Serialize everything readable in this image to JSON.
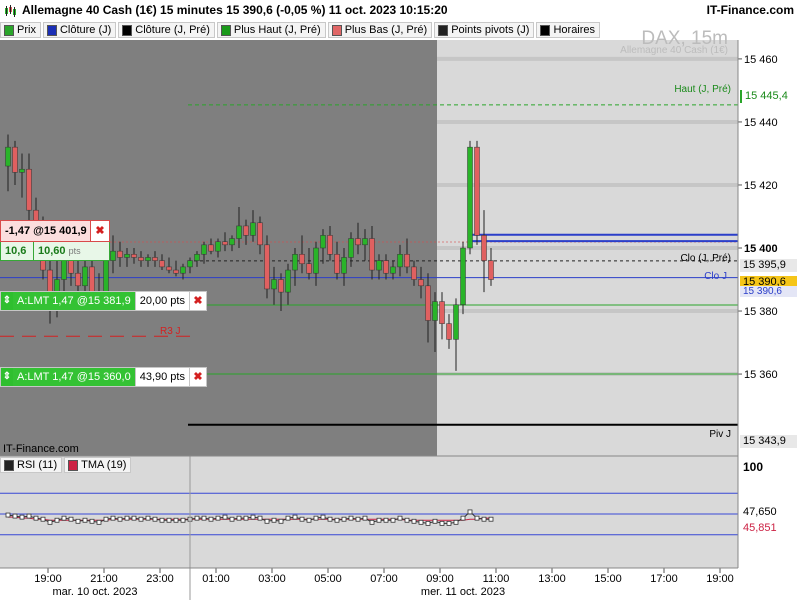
{
  "header": {
    "title": "Allemagne 40 Cash (1€) 15 minutes 15 390,6 (-0,05 %) 11 oct. 2023 10:15:20",
    "brand": "IT-Finance.com"
  },
  "legend": [
    {
      "label": "Prix",
      "color": "#2aa52a"
    },
    {
      "label": "Clôture (J)",
      "color": "#1b2fb5"
    },
    {
      "label": "Clôture (J, Pré)",
      "color": "#000000"
    },
    {
      "label": "Plus Haut (J, Pré)",
      "color": "#1a9a1a"
    },
    {
      "label": "Plus Bas (J, Pré)",
      "color": "#e06666"
    },
    {
      "label": "Points pivots (J)",
      "color": "#222222"
    },
    {
      "label": "Horaires",
      "color": "#000000"
    }
  ],
  "watermark": {
    "symbol": "DAX, 15m",
    "name": "Allemagne 40 Cash (1€)"
  },
  "footer_brand": "IT-Finance.com",
  "position": {
    "value": "-1,47 @15 401,9",
    "close": "✖",
    "pl_points": "10,6",
    "pl_value": "10,60",
    "pl_unit": "pts"
  },
  "orders": [
    {
      "grip": "⇕",
      "label": "A:LMT 1,47 @15 381,9",
      "pts": "20,00 pts",
      "close": "✖"
    },
    {
      "grip": "⇕",
      "label": "A:LMT 1,47 @15 360,0",
      "pts": "43,90 pts",
      "close": "✖"
    }
  ],
  "line_labels": {
    "high_prev": "Haut (J, Pré)",
    "close_prev": "Clo (J, Pré)",
    "close_j": "Clo J",
    "pivot": "Piv J",
    "r3": "R3 J"
  },
  "price_tags": {
    "high_prev": "15 445,4",
    "close_prev": "15 395,9",
    "current": "15 390,6",
    "close_j": "15 390,6",
    "pivot": "15 343,9"
  },
  "colors": {
    "up": "#29b429",
    "down": "#e06060",
    "wick": "#222222",
    "session_shade": "#7f7f7f",
    "chart_bg": "#d9d9d9",
    "blue_line": "#2b3ec9",
    "green_line": "#2aa52a",
    "rsi_line": "#333333",
    "tma_line": "#cc2244",
    "rsi_band": "#3949d6",
    "current_tag": "#f5c518"
  },
  "rsi_legend": [
    {
      "label": "RSI (11)",
      "color": "#222222"
    },
    {
      "label": "TMA (19)",
      "color": "#cc2244"
    }
  ],
  "rsi_tags": {
    "max": "100",
    "rsi": "47,650",
    "tma": "45,851"
  },
  "chart_data": {
    "type": "candlestick",
    "title": "Allemagne 40 Cash (1€) 15 minutes",
    "y_axis": {
      "ticks": [
        "15 460",
        "15 440",
        "15 420",
        "15 400",
        "15 380",
        "15 360"
      ],
      "ylim": [
        15334,
        15466
      ]
    },
    "x_axis": {
      "ticks": [
        "19:00",
        "21:00",
        "23:00",
        "01:00",
        "03:00",
        "05:00",
        "07:00",
        "09:00",
        "11:00",
        "13:00",
        "15:00",
        "17:00",
        "19:00"
      ],
      "dates": [
        "mar. 10 oct. 2023",
        "mer. 11 oct. 2023"
      ]
    },
    "levels": {
      "high_prev": 15445.4,
      "close_prev": 15395.9,
      "close_j": 15390.6,
      "pivot": 15343.9,
      "r3": 15372,
      "order_1": 15381.9,
      "order_2": 15360.0,
      "position": 15401.9,
      "blue_band": [
        15404.2,
        15402.2
      ],
      "green_low": 15360.3
    },
    "candles": [
      {
        "o": 15426,
        "h": 15436,
        "l": 15418,
        "c": 15432
      },
      {
        "o": 15432,
        "h": 15434,
        "l": 15420,
        "c": 15424
      },
      {
        "o": 15424,
        "h": 15430,
        "l": 15416,
        "c": 15425
      },
      {
        "o": 15425,
        "h": 15430,
        "l": 15408,
        "c": 15412
      },
      {
        "o": 15412,
        "h": 15416,
        "l": 15398,
        "c": 15400
      },
      {
        "o": 15400,
        "h": 15410,
        "l": 15390,
        "c": 15393
      },
      {
        "o": 15393,
        "h": 15396,
        "l": 15376,
        "c": 15382
      },
      {
        "o": 15382,
        "h": 15396,
        "l": 15378,
        "c": 15390
      },
      {
        "o": 15390,
        "h": 15402,
        "l": 15386,
        "c": 15398
      },
      {
        "o": 15398,
        "h": 15402,
        "l": 15388,
        "c": 15392
      },
      {
        "o": 15392,
        "h": 15396,
        "l": 15382,
        "c": 15388
      },
      {
        "o": 15388,
        "h": 15398,
        "l": 15384,
        "c": 15394
      },
      {
        "o": 15394,
        "h": 15398,
        "l": 15382,
        "c": 15386
      },
      {
        "o": 15386,
        "h": 15392,
        "l": 15380,
        "c": 15384
      },
      {
        "o": 15384,
        "h": 15398,
        "l": 15382,
        "c": 15396
      },
      {
        "o": 15396,
        "h": 15404,
        "l": 15392,
        "c": 15399
      },
      {
        "o": 15399,
        "h": 15402,
        "l": 15394,
        "c": 15397
      },
      {
        "o": 15397,
        "h": 15400,
        "l": 15394,
        "c": 15398
      },
      {
        "o": 15398,
        "h": 15400,
        "l": 15395,
        "c": 15397
      },
      {
        "o": 15397,
        "h": 15399,
        "l": 15394,
        "c": 15396
      },
      {
        "o": 15396,
        "h": 15398,
        "l": 15394,
        "c": 15397
      },
      {
        "o": 15397,
        "h": 15399,
        "l": 15394,
        "c": 15396
      },
      {
        "o": 15396,
        "h": 15398,
        "l": 15393,
        "c": 15394
      },
      {
        "o": 15394,
        "h": 15397,
        "l": 15392,
        "c": 15393
      },
      {
        "o": 15393,
        "h": 15396,
        "l": 15391,
        "c": 15392
      },
      {
        "o": 15392,
        "h": 15395,
        "l": 15390,
        "c": 15394
      },
      {
        "o": 15394,
        "h": 15397,
        "l": 15392,
        "c": 15396
      },
      {
        "o": 15396,
        "h": 15399,
        "l": 15394,
        "c": 15398
      },
      {
        "o": 15398,
        "h": 15402,
        "l": 15395,
        "c": 15401
      },
      {
        "o": 15401,
        "h": 15403,
        "l": 15398,
        "c": 15399
      },
      {
        "o": 15399,
        "h": 15403,
        "l": 15397,
        "c": 15402
      },
      {
        "o": 15402,
        "h": 15405,
        "l": 15399,
        "c": 15401
      },
      {
        "o": 15401,
        "h": 15404,
        "l": 15399,
        "c": 15403
      },
      {
        "o": 15403,
        "h": 15413,
        "l": 15400,
        "c": 15407
      },
      {
        "o": 15407,
        "h": 15409,
        "l": 15401,
        "c": 15404
      },
      {
        "o": 15404,
        "h": 15412,
        "l": 15402,
        "c": 15408
      },
      {
        "o": 15408,
        "h": 15410,
        "l": 15398,
        "c": 15401
      },
      {
        "o": 15401,
        "h": 15404,
        "l": 15384,
        "c": 15387
      },
      {
        "o": 15387,
        "h": 15394,
        "l": 15382,
        "c": 15390
      },
      {
        "o": 15390,
        "h": 15392,
        "l": 15380,
        "c": 15386
      },
      {
        "o": 15386,
        "h": 15395,
        "l": 15382,
        "c": 15393
      },
      {
        "o": 15393,
        "h": 15400,
        "l": 15388,
        "c": 15398
      },
      {
        "o": 15398,
        "h": 15404,
        "l": 15392,
        "c": 15395
      },
      {
        "o": 15395,
        "h": 15400,
        "l": 15390,
        "c": 15392
      },
      {
        "o": 15392,
        "h": 15402,
        "l": 15388,
        "c": 15400
      },
      {
        "o": 15400,
        "h": 15406,
        "l": 15395,
        "c": 15404
      },
      {
        "o": 15404,
        "h": 15407,
        "l": 15396,
        "c": 15398
      },
      {
        "o": 15398,
        "h": 15402,
        "l": 15390,
        "c": 15392
      },
      {
        "o": 15392,
        "h": 15400,
        "l": 15388,
        "c": 15397
      },
      {
        "o": 15397,
        "h": 15405,
        "l": 15394,
        "c": 15403
      },
      {
        "o": 15403,
        "h": 15408,
        "l": 15398,
        "c": 15401
      },
      {
        "o": 15401,
        "h": 15406,
        "l": 15396,
        "c": 15403
      },
      {
        "o": 15403,
        "h": 15407,
        "l": 15390,
        "c": 15393
      },
      {
        "o": 15393,
        "h": 15398,
        "l": 15390,
        "c": 15396
      },
      {
        "o": 15396,
        "h": 15398,
        "l": 15390,
        "c": 15392
      },
      {
        "o": 15392,
        "h": 15396,
        "l": 15390,
        "c": 15394
      },
      {
        "o": 15394,
        "h": 15401,
        "l": 15391,
        "c": 15398
      },
      {
        "o": 15398,
        "h": 15403,
        "l": 15392,
        "c": 15394
      },
      {
        "o": 15394,
        "h": 15396,
        "l": 15388,
        "c": 15390
      },
      {
        "o": 15390,
        "h": 15394,
        "l": 15384,
        "c": 15388
      },
      {
        "o": 15388,
        "h": 15392,
        "l": 15370,
        "c": 15377
      },
      {
        "o": 15377,
        "h": 15386,
        "l": 15367,
        "c": 15383
      },
      {
        "o": 15383,
        "h": 15386,
        "l": 15371,
        "c": 15376
      },
      {
        "o": 15376,
        "h": 15379,
        "l": 15368,
        "c": 15371
      },
      {
        "o": 15371,
        "h": 15384,
        "l": 15361,
        "c": 15382
      },
      {
        "o": 15382,
        "h": 15402,
        "l": 15379,
        "c": 15400
      },
      {
        "o": 15400,
        "h": 15434,
        "l": 15398,
        "c": 15432
      },
      {
        "o": 15432,
        "h": 15434,
        "l": 15401,
        "c": 15404
      },
      {
        "o": 15404,
        "h": 15412,
        "l": 15386,
        "c": 15396
      },
      {
        "o": 15396,
        "h": 15400,
        "l": 15388,
        "c": 15390
      }
    ],
    "rsi": [
      49,
      48,
      47,
      48,
      46,
      45,
      42,
      44,
      46,
      45,
      43,
      44,
      43,
      42,
      45,
      46,
      45,
      46,
      46,
      45,
      46,
      45,
      44,
      44,
      44,
      44,
      45,
      46,
      46,
      45,
      46,
      47,
      45,
      46,
      46,
      47,
      46,
      43,
      44,
      43,
      46,
      47,
      45,
      44,
      46,
      47,
      45,
      44,
      45,
      46,
      45,
      46,
      42,
      44,
      44,
      44,
      46,
      44,
      43,
      42,
      41,
      43,
      41,
      41,
      42,
      46,
      52,
      46,
      45,
      45
    ],
    "tma": [
      47,
      47,
      46,
      46,
      45,
      45,
      44,
      44,
      44,
      44,
      44,
      44,
      44,
      44,
      44,
      45,
      45,
      45,
      45,
      45,
      45,
      45,
      45,
      45,
      45,
      45,
      45,
      45,
      45,
      45,
      45,
      45,
      45,
      45,
      45,
      45,
      45,
      45,
      45,
      45,
      45,
      45,
      45,
      45,
      45,
      45,
      45,
      45,
      45,
      45,
      45,
      45,
      45,
      45,
      45,
      45,
      45,
      44,
      44,
      44,
      44,
      44,
      44,
      44,
      44,
      44,
      45,
      45,
      46,
      46
    ],
    "rsi_levels": {
      "upper": 70,
      "mid": 50,
      "lower": 30
    }
  }
}
